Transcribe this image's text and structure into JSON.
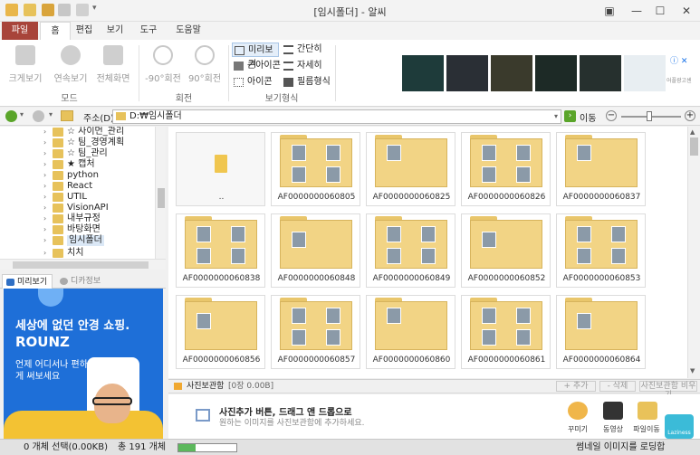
{
  "window": {
    "title": "[임시폴더] - 알씨"
  },
  "menu": {
    "tabs": [
      "파일",
      "홈",
      "편집",
      "보기",
      "도구",
      "도움말"
    ]
  },
  "ribbon": {
    "mode_buttons": [
      "크게보기",
      "연속보기",
      "전체화면"
    ],
    "mode_group": "모드",
    "rotate_buttons": [
      "-90°회전",
      "90°회전"
    ],
    "rotate_group": "회전",
    "view_options": [
      "미리보기",
      "간단히",
      "큰아이콘",
      "자세히",
      "아이콘",
      "필름형식"
    ],
    "view_group": "보기형식",
    "ad_tag": "광고",
    "ad_info": "ⓘ ✕",
    "ad_small": "어플광고센"
  },
  "address": {
    "label": "주소(D)",
    "path": "D:₩임시폴더",
    "go": "이동"
  },
  "tree": {
    "items": [
      "☆ 사이먼_관리",
      "☆ 팀_경영계획",
      "☆ 팀_관리",
      "★ 캡처",
      "python",
      "React",
      "UTIL",
      "VisionAPI",
      "내부규정",
      "바탕화면",
      "임시폴더",
      "치치"
    ]
  },
  "preview": {
    "tabs": [
      "미리보기",
      "디카정보"
    ],
    "ad": {
      "headline": "세상에 없던 안경 쇼핑.",
      "brand": "ROUNZ",
      "sub": "언제 어디서나 편하게 써보세요"
    }
  },
  "grid": {
    "parent_label": "..",
    "folders": [
      "AF0000000060805",
      "AF0000000060825",
      "AF0000000060826",
      "AF0000000060837",
      "AF0000000060838",
      "AF0000000060848",
      "AF0000000060849",
      "AF0000000060852",
      "AF0000000060853",
      "AF0000000060856",
      "AF0000000060857",
      "AF0000000060860",
      "AF0000000060861",
      "AF0000000060864"
    ]
  },
  "storage": {
    "title": "사진보관함",
    "count": "[0장 0.00B]",
    "add": "+ 추가",
    "remove": "- 삭제",
    "clear": "사진보관함 비우기",
    "hint_title": "사진추가 버튼, 드래그 앤 드롭으로",
    "hint_sub": "원하는 이미지를 사진보관함에 추가하세요.",
    "actions": [
      "꾸미기",
      "동영상",
      "파일이동"
    ],
    "logo": "Laziness"
  },
  "status": {
    "selected": "0 개체 선택(0.00KB)",
    "total": "총 191 개체",
    "loading": "썸네일 이미지를 로딩합"
  }
}
